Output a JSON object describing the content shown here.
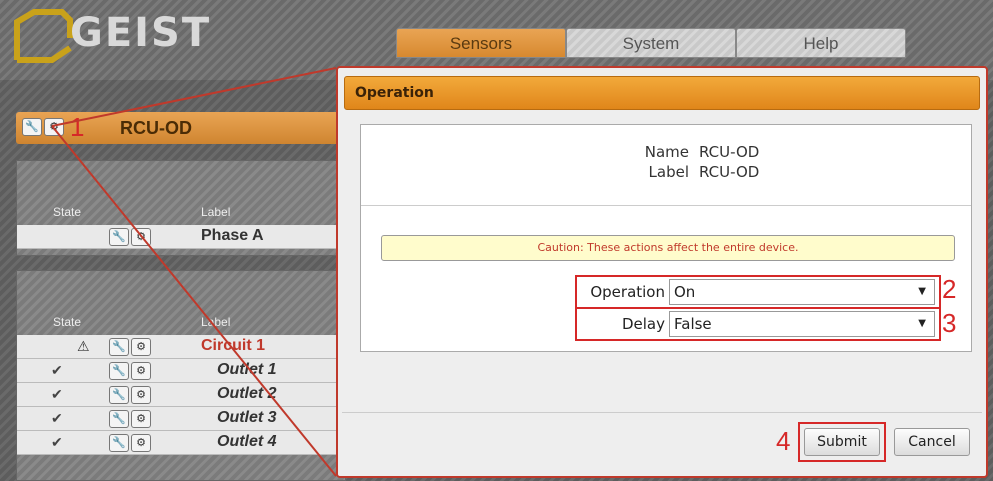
{
  "header": {
    "logo_text": "GEIST",
    "nav": [
      {
        "label": "Sensors",
        "active": true
      },
      {
        "label": "System",
        "active": false
      },
      {
        "label": "Help",
        "active": false
      }
    ]
  },
  "sidebar": {
    "device_name": "RCU-OD",
    "callout_1": "1",
    "panel1": {
      "state_header": "State",
      "label_header": "Label",
      "rows": [
        {
          "label": "Phase A"
        }
      ]
    },
    "panel2": {
      "state_header": "State",
      "label_header": "Label",
      "rows": [
        {
          "state_icon": "alert-icon",
          "label": "Circuit 1"
        },
        {
          "state_icon": "check-icon",
          "label": "Outlet 1"
        },
        {
          "state_icon": "check-icon",
          "label": "Outlet 2"
        },
        {
          "state_icon": "check-icon",
          "label": "Outlet 3"
        },
        {
          "state_icon": "check-icon",
          "label": "Outlet 4"
        }
      ]
    }
  },
  "dialog": {
    "title": "Operation",
    "name_label": "Name",
    "name_value": "RCU-OD",
    "label_label": "Label",
    "label_value": "RCU-OD",
    "caution": "Caution: These actions affect the entire device.",
    "operation_label": "Operation",
    "operation_value": "On",
    "delay_label": "Delay",
    "delay_value": "False",
    "callout_2": "2",
    "callout_3": "3",
    "callout_4": "4",
    "submit_label": "Submit",
    "cancel_label": "Cancel"
  },
  "colors": {
    "accent_orange": "#e0861a",
    "callout_red": "#d62828",
    "caution_bg": "#fffccc"
  }
}
